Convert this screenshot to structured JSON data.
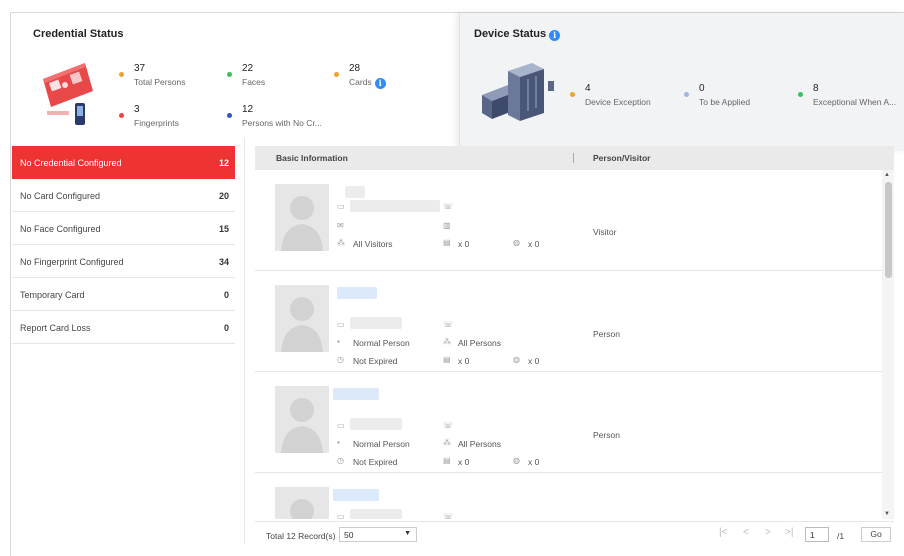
{
  "credential_status": {
    "title": "Credential Status",
    "stats": [
      {
        "value": "37",
        "label": "Total Persons",
        "color": "#f0a030"
      },
      {
        "value": "22",
        "label": "Faces",
        "color": "#3cc060"
      },
      {
        "value": "28",
        "label": "Cards",
        "color": "#f0a030",
        "info_icon": true
      },
      {
        "value": "3",
        "label": "Fingerprints",
        "color": "#ee4444"
      },
      {
        "value": "12",
        "label": "Persons with No Cr...",
        "color": "#3355cc"
      }
    ]
  },
  "device_status": {
    "title": "Device Status",
    "stats": [
      {
        "value": "4",
        "label": "Device Exception",
        "color": "#f0a030"
      },
      {
        "value": "0",
        "label": "To be Applied",
        "color": "#a0b4e6"
      },
      {
        "value": "8",
        "label": "Exceptional When A...",
        "color": "#3cc060"
      }
    ]
  },
  "sidebar": {
    "items": [
      {
        "label": "No Credential Configured",
        "count": "12",
        "active": true
      },
      {
        "label": "No Card Configured",
        "count": "20"
      },
      {
        "label": "No Face Configured",
        "count": "15"
      },
      {
        "label": "No Fingerprint Configured",
        "count": "34"
      },
      {
        "label": "Temporary Card",
        "count": "0"
      },
      {
        "label": "Report Card Loss",
        "count": "0"
      }
    ]
  },
  "table": {
    "columns": [
      "Basic Information",
      "Person/Visitor"
    ],
    "rows": [
      {
        "group": "All Visitors",
        "card_count": "x 0",
        "finger_count": "x 0",
        "type": "Visitor"
      },
      {
        "person_type": "Normal Person",
        "group": "All Persons",
        "expiry": "Not Expired",
        "card_count": "x 0",
        "finger_count": "x 0",
        "type": "Person"
      },
      {
        "person_type": "Normal Person",
        "group": "All Persons",
        "expiry": "Not Expired",
        "card_count": "x 0",
        "finger_count": "x 0",
        "type": "Person"
      }
    ]
  },
  "footer": {
    "total": "Total 12 Record(s)",
    "page_size": "50",
    "page_input": "1",
    "page_total": "/1",
    "go_label": "Go"
  },
  "colors": {
    "accent": "#ee3333",
    "info": "#2f8df5"
  }
}
